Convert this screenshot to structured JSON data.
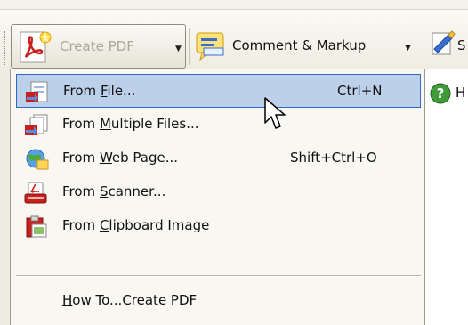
{
  "toolbar": {
    "create_pdf": {
      "label": "Create PDF",
      "icon": "create-pdf-icon"
    },
    "comment_markup": {
      "label": "Comment & Markup",
      "icon": "comment-markup-icon"
    },
    "sign_partial": {
      "label": "S",
      "icon": "sign-icon"
    }
  },
  "help_partial": {
    "label": "H",
    "icon": "help-icon"
  },
  "menu": {
    "items": [
      {
        "pre": "From ",
        "mnemonic": "F",
        "post": "ile...",
        "shortcut": "Ctrl+N",
        "icon": "file-pdf-icon",
        "selected": true
      },
      {
        "pre": "From ",
        "mnemonic": "M",
        "post": "ultiple Files...",
        "shortcut": "",
        "icon": "multiple-files-icon",
        "selected": false
      },
      {
        "pre": "From ",
        "mnemonic": "W",
        "post": "eb Page...",
        "shortcut": "Shift+Ctrl+O",
        "icon": "web-page-icon",
        "selected": false
      },
      {
        "pre": "From ",
        "mnemonic": "S",
        "post": "canner...",
        "shortcut": "",
        "icon": "scanner-icon",
        "selected": false
      },
      {
        "pre": "From ",
        "mnemonic": "C",
        "post": "lipboard Image",
        "shortcut": "",
        "icon": "clipboard-image-icon",
        "selected": false
      }
    ],
    "howto": {
      "pre": "",
      "mnemonic": "H",
      "post": "ow To...Create PDF"
    }
  },
  "colors": {
    "selection_fill": "#bcd0ea",
    "selection_border": "#3168c5",
    "menu_bg": "#f8f7f2",
    "pdf_red": "#c8201d"
  }
}
